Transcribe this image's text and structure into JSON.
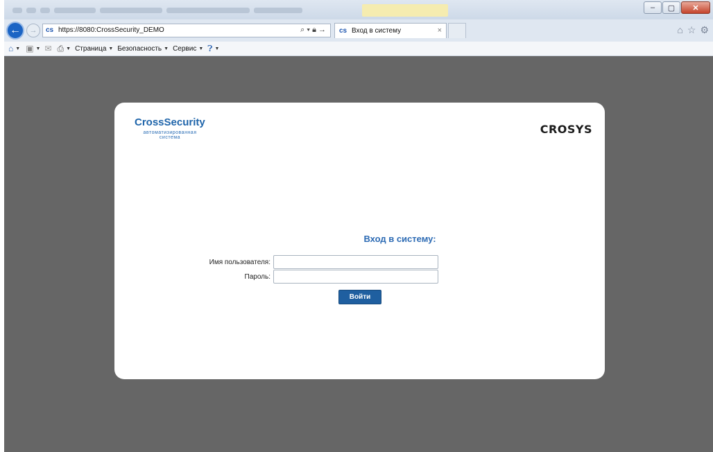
{
  "browser": {
    "url": "https://8080:CrossSecurity_DEMO",
    "tab_title": "Вход в систему",
    "tab_close": "×",
    "window_buttons": {
      "minimize": "–",
      "maximize": "▢",
      "close": "✕"
    },
    "command_bar": {
      "page_label": "Страница",
      "security_label": "Безопасность",
      "tools_label": "Сервис"
    }
  },
  "brand": {
    "title": "CrossSecurity",
    "subtitle": "автоматизированная система",
    "logo": "CROSYS"
  },
  "login": {
    "heading": "Вход в систему:",
    "username_label": "Имя пользователя:",
    "username_value": "",
    "password_label": "Пароль:",
    "password_value": "",
    "submit_label": "Войти"
  },
  "colors": {
    "viewport_bg": "#666666",
    "brand_blue": "#1e64aa",
    "button_blue": "#1f5fa0"
  }
}
